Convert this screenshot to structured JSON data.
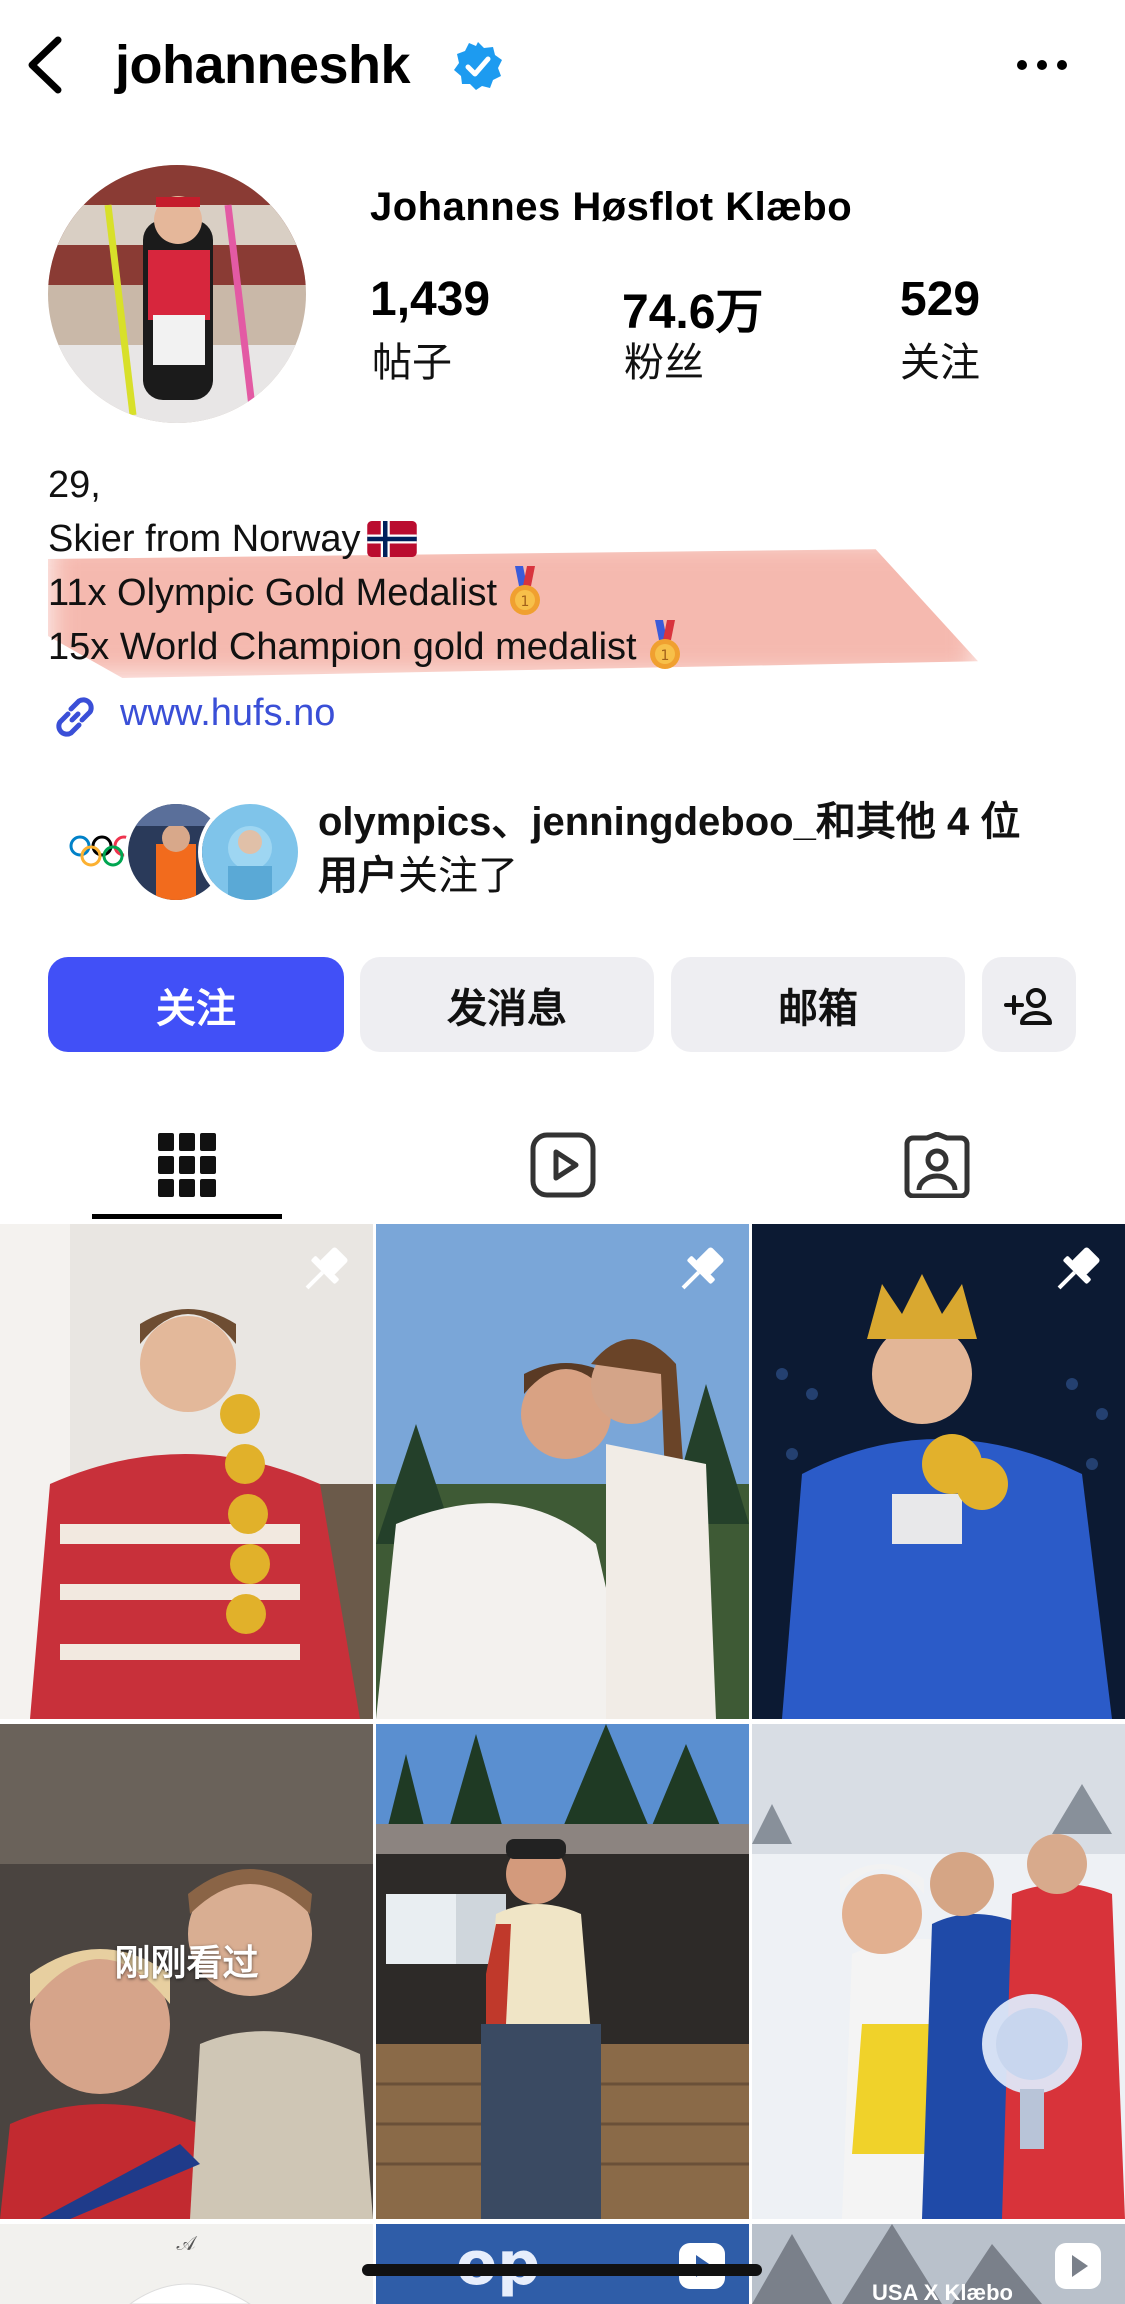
{
  "header": {
    "username": "johanneshk",
    "icons": [
      "back-arrow-icon",
      "verified-badge-icon",
      "more-options-icon"
    ]
  },
  "profile": {
    "full_name": "Johannes Høsflot Klæbo",
    "stats": {
      "posts": {
        "value": "1,439",
        "label": "帖子"
      },
      "followers": {
        "value": "74.6万",
        "label": "粉丝"
      },
      "following": {
        "value": "529",
        "label": "关注"
      }
    },
    "bio": {
      "line1": "29,",
      "line2": "Skier from Norway",
      "line3": "11x Olympic Gold Medalist",
      "line4": "15x World Champion gold medalist"
    },
    "link": "www.hufs.no"
  },
  "followed_by": {
    "names": "olympics、jenningdeboo_",
    "middle": "和其他 4 位",
    "users": "用户",
    "suffix": "关注了"
  },
  "buttons": {
    "follow": "关注",
    "message": "发消息",
    "email": "邮箱"
  },
  "tabs": [
    "grid-icon",
    "reels-icon",
    "tagged-icon"
  ],
  "grid": {
    "recently_viewed": "刚刚看过",
    "partial_caption": "USA X Klæbo"
  },
  "colors": {
    "accent": "#4150f7",
    "link": "#3a4fd7",
    "highlight": "#ec806e"
  }
}
